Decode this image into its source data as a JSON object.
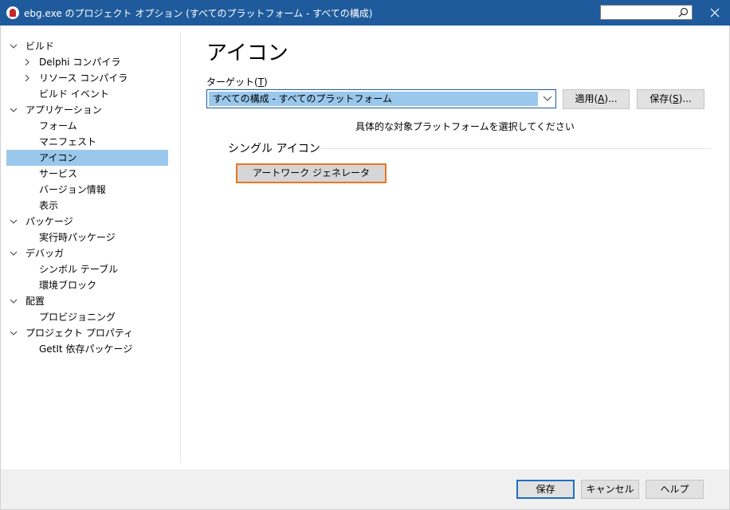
{
  "window": {
    "title": "ebg.exe のプロジェクト オプション (すべてのプラットフォーム - すべての構成)"
  },
  "icons": {
    "app": "app-logo-icon",
    "search": "search-icon",
    "close": "close-icon",
    "expanded": "chevron-down-icon",
    "collapsed": "chevron-right-icon",
    "dropdown": "chevron-down-icon"
  },
  "tree": [
    {
      "label": "ビルド",
      "expander": "expanded",
      "selected": false
    },
    {
      "label": "Delphi コンパイラ",
      "expander": "collapsed",
      "selected": false
    },
    {
      "label": "リソース コンパイラ",
      "expander": "collapsed",
      "selected": false
    },
    {
      "label": "ビルド イベント",
      "expander": "",
      "selected": false
    },
    {
      "label": "アプリケーション",
      "expander": "expanded",
      "selected": false
    },
    {
      "label": "フォーム",
      "expander": "",
      "selected": false
    },
    {
      "label": "マニフェスト",
      "expander": "",
      "selected": false
    },
    {
      "label": "アイコン",
      "expander": "",
      "selected": true
    },
    {
      "label": "サービス",
      "expander": "",
      "selected": false
    },
    {
      "label": "バージョン情報",
      "expander": "",
      "selected": false
    },
    {
      "label": "表示",
      "expander": "",
      "selected": false
    },
    {
      "label": "パッケージ",
      "expander": "expanded",
      "selected": false
    },
    {
      "label": "実行時パッケージ",
      "expander": "",
      "selected": false
    },
    {
      "label": "デバッガ",
      "expander": "expanded",
      "selected": false
    },
    {
      "label": "シンボル テーブル",
      "expander": "",
      "selected": false
    },
    {
      "label": "環境ブロック",
      "expander": "",
      "selected": false
    },
    {
      "label": "配置",
      "expander": "expanded",
      "selected": false
    },
    {
      "label": "プロビジョニング",
      "expander": "",
      "selected": false
    },
    {
      "label": "プロジェクト プロパティ",
      "expander": "expanded",
      "selected": false
    },
    {
      "label": "GetIt 依存パッケージ",
      "expander": "",
      "selected": false
    }
  ],
  "main": {
    "title": "アイコン",
    "target": {
      "label": "ターゲット",
      "mnemonic": "T",
      "selected": "すべての構成 - すべてのプラットフォーム",
      "apply_label": "適用",
      "apply_mnemonic": "A",
      "save_label": "保存",
      "save_mnemonic": "S",
      "ellipsis": "..."
    },
    "hint": "具体的な対象プラットフォームを選択してください",
    "section": "シングル アイコン",
    "artwork_button": "アートワーク ジェネレータ"
  },
  "footer": {
    "save": "保存",
    "cancel": "キャンセル",
    "help": "ヘルプ"
  },
  "colors": {
    "titlebar": "#1f5b9c",
    "selection": "#99c8ec",
    "accent_outline": "#e87722",
    "primary_border": "#1f6ec4",
    "footer": "#f0f0f0"
  }
}
